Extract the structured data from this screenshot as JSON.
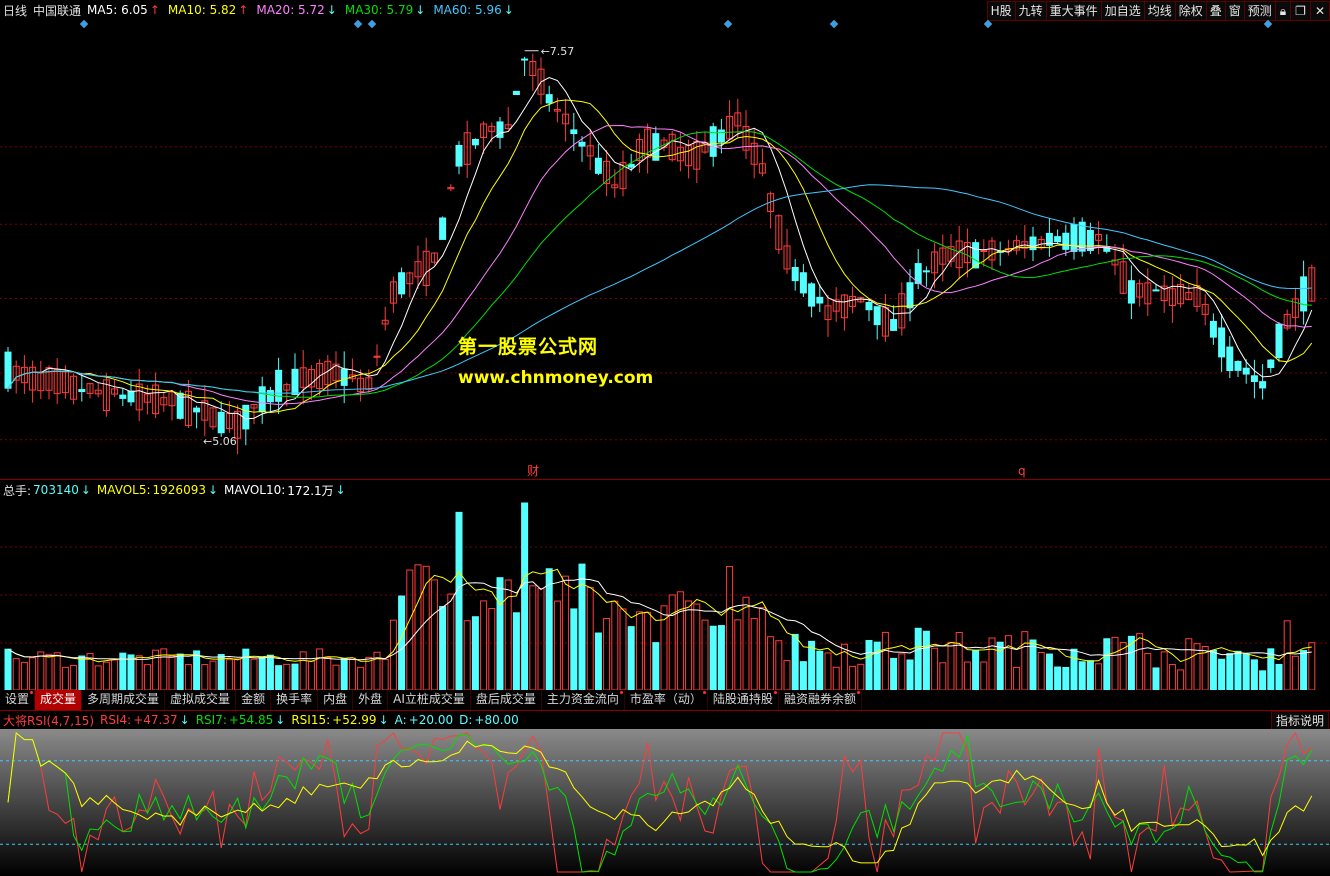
{
  "header": {
    "period": "日线",
    "stock_name": "中国联通",
    "ma": [
      {
        "label": "MA5:",
        "value": "6.05",
        "arrow": "↑",
        "color": "#ffffff"
      },
      {
        "label": "MA10:",
        "value": "5.82",
        "arrow": "↑",
        "color": "#ffff00"
      },
      {
        "label": "MA20:",
        "value": "5.72",
        "arrow": "↓",
        "color": "#ff80ff"
      },
      {
        "label": "MA30:",
        "value": "5.79",
        "arrow": "↓",
        "color": "#00e000"
      },
      {
        "label": "MA60:",
        "value": "5.96",
        "arrow": "↓",
        "color": "#40c8ff"
      }
    ]
  },
  "toolbar": [
    "H股",
    "九转",
    "重大事件",
    "加自选",
    "均线",
    "除权",
    "叠",
    "窗",
    "预测",
    "lock-icon",
    "restore-icon",
    "close-icon"
  ],
  "price_chart": {
    "high_marker": "7.57",
    "low_marker": "5.06",
    "event_left": "财",
    "event_right": "q",
    "watermark_title": "第一股票公式网",
    "watermark_url": "www.chnmoney.com"
  },
  "volume_header": {
    "total_label": "总手:",
    "total_value": "703140",
    "total_arrow": "↓",
    "mavol5_label": "MAVOL5:",
    "mavol5_value": "1926093",
    "mavol5_arrow": "↓",
    "mavol10_label": "MAVOL10:",
    "mavol10_value": "172.1万",
    "mavol10_arrow": "↓"
  },
  "tabs": [
    {
      "label": "设置",
      "dot": true
    },
    {
      "label": "成交量",
      "active": true
    },
    {
      "label": "多周期成交量"
    },
    {
      "label": "虚拟成交量"
    },
    {
      "label": "金额"
    },
    {
      "label": "换手率"
    },
    {
      "label": "内盘"
    },
    {
      "label": "外盘"
    },
    {
      "label": "AI立桩成交量"
    },
    {
      "label": "盘后成交量"
    },
    {
      "label": "主力资金流向",
      "dot": true
    },
    {
      "label": "市盈率（动）",
      "dot": true
    },
    {
      "label": "陆股通持股",
      "dot": true
    },
    {
      "label": "融资融券余额",
      "dot": true
    }
  ],
  "rsi_header": {
    "name": "大将RSI(4,7,15)",
    "rsi4_label": "RSI4:",
    "rsi4_value": "+47.37",
    "rsi4_arrow": "↓",
    "rsi7_label": "RSI7:",
    "rsi7_value": "+54.85",
    "rsi7_arrow": "↓",
    "rsi15_label": "RSI15:",
    "rsi15_value": "+52.99",
    "rsi15_arrow": "↓",
    "a_label": "A:",
    "a_value": "+20.00",
    "d_label": "D:",
    "d_value": "+80.00"
  },
  "indicator_button": "指标说明",
  "colors": {
    "up": "#ff3c3c",
    "down": "#54ffff",
    "ma5": "#ffffff",
    "ma10": "#ffff00",
    "ma20": "#ff80ff",
    "ma30": "#00e000",
    "ma60": "#40c8ff",
    "grid": "#7a0000"
  }
}
